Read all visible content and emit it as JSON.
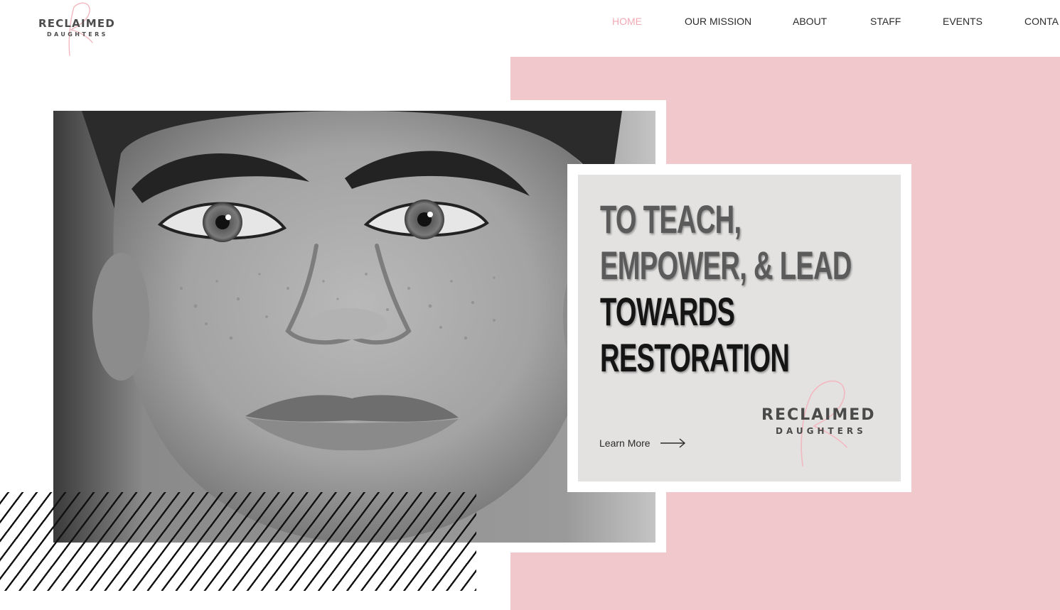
{
  "brand": {
    "name_line1": "RECLAIMED",
    "name_line2": "DAUGHTERS"
  },
  "nav": {
    "items": [
      {
        "label": "HOME",
        "active": true
      },
      {
        "label": "OUR MISSION",
        "active": false
      },
      {
        "label": "ABOUT",
        "active": false
      },
      {
        "label": "STAFF",
        "active": false
      },
      {
        "label": "EVENTS",
        "active": false
      },
      {
        "label": "CONTA",
        "active": false
      }
    ]
  },
  "hero": {
    "headline_lines": [
      "TO TEACH,",
      "EMPOWER, & LEAD",
      "TOWARDS",
      "RESTORATION"
    ],
    "cta_label": "Learn More",
    "cta_icon": "arrow-right-icon",
    "photo_subject": "portrait-photo",
    "card_logo_line1": "RECLAIMED",
    "card_logo_line2": "DAUGHTERS"
  },
  "colors": {
    "accent_pink": "#f1c9cc",
    "nav_active": "#f2a9b4",
    "card_bg": "#e3e2e1",
    "text_dark": "#151515",
    "text_grey": "#5b5b5b"
  }
}
